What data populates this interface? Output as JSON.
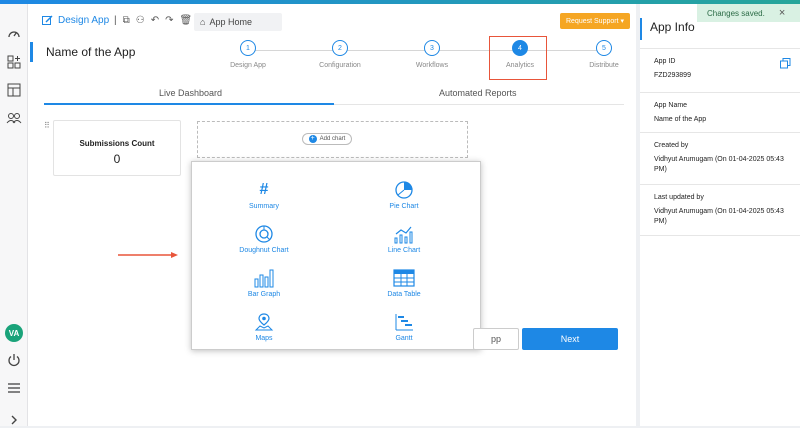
{
  "toolbar": {
    "design_app_label": "Design App",
    "app_home_label": "App Home",
    "request_support_label": "Request Support"
  },
  "app": {
    "name": "Name of the App"
  },
  "steps": [
    {
      "number": "1",
      "label": "Design App"
    },
    {
      "number": "2",
      "label": "Configuration"
    },
    {
      "number": "3",
      "label": "Workflows"
    },
    {
      "number": "4",
      "label": "Analytics",
      "active": true
    },
    {
      "number": "5",
      "label": "Distribute"
    }
  ],
  "tabs": [
    {
      "label": "Live Dashboard",
      "active": true
    },
    {
      "label": "Automated Reports"
    }
  ],
  "card": {
    "title": "Submissions Count",
    "value": "0"
  },
  "add_chart_label": "Add chart",
  "chart_options": [
    {
      "label": "Summary",
      "icon": "hash-icon"
    },
    {
      "label": "Pie Chart",
      "icon": "pie-chart-icon"
    },
    {
      "label": "Doughnut Chart",
      "icon": "doughnut-chart-icon"
    },
    {
      "label": "Line Chart",
      "icon": "line-chart-icon"
    },
    {
      "label": "Bar Graph",
      "icon": "bar-graph-icon"
    },
    {
      "label": "Data Table",
      "icon": "data-table-icon"
    },
    {
      "label": "Maps",
      "icon": "maps-icon"
    },
    {
      "label": "Gantt",
      "icon": "gantt-icon"
    }
  ],
  "buttons": {
    "back_label": "pp",
    "next_label": "Next"
  },
  "nav": {
    "avatar_initials": "VA"
  },
  "side": {
    "title": "App Info",
    "toast": "Changes saved.",
    "toast_close": "×",
    "fields": [
      {
        "key": "App ID",
        "value": "FZD293899"
      },
      {
        "key": "App Name",
        "value": "Name of the App"
      },
      {
        "key": "Created by",
        "value": "Vidhyut Arumugam (On 01-04-2025 05:43 PM)"
      },
      {
        "key": "Last updated by",
        "value": "Vidhyut Arumugam (On 01-04-2025 05:43 PM)"
      }
    ]
  },
  "colors": {
    "accent": "#1e88e5",
    "highlight": "#e8553a",
    "support": "#f5a623"
  }
}
